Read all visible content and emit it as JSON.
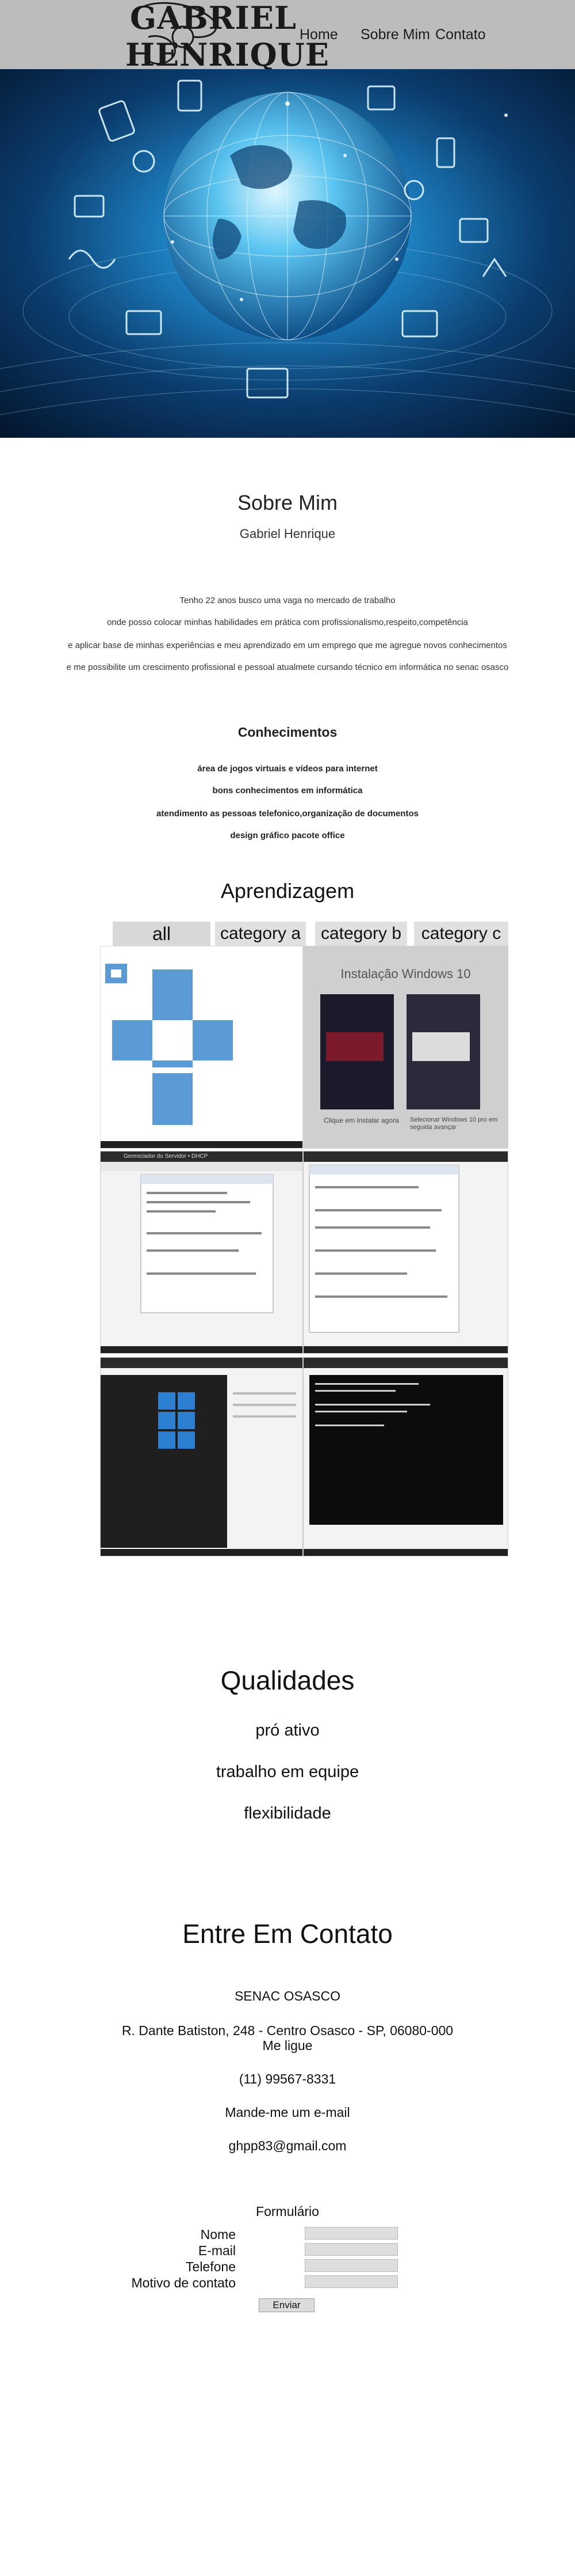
{
  "header": {
    "logo_line1": "GABRIEL",
    "logo_line2": "HENRIQUE",
    "nav": [
      {
        "label": "Home"
      },
      {
        "label": "Sobre Mim"
      },
      {
        "label": "Contato"
      }
    ]
  },
  "sobre": {
    "title": "Sobre Mim",
    "name": "Gabriel Henrique",
    "paragraph": [
      "Tenho 22 anos busco uma vaga no mercado de trabalho",
      "onde posso colocar minhas habilidades em prática com profissionalismo,respeito,competência",
      "e aplicar base de minhas experiências e meu aprendizado em um emprego que me agregue novos conhecimentos",
      "e me possibilite um crescimento profissional e pessoal atualmete cursando técnico em informática no senac osasco"
    ]
  },
  "conhecimentos": {
    "title": "Conhecimentos",
    "items": [
      "área de jogos virtuais e vídeos para internet",
      "bons conhecimentos em informática",
      "atendimento as pessoas telefonico,organização de documentos",
      "design gráfico pacote office"
    ]
  },
  "aprendizagem": {
    "title": "Aprendizagem",
    "tabs": [
      {
        "label": "all"
      },
      {
        "label": "category a"
      },
      {
        "label": "category b"
      },
      {
        "label": "category c"
      }
    ],
    "install_title": "Instalação Windows 10",
    "install_caption_left": "Clique em Instalar agora",
    "install_caption_right": "Selecionar Windows 10 pro em seguida avançar",
    "window_title": "Gerenciador do Servidor • DHCP"
  },
  "qualidades": {
    "title": "Qualidades",
    "items": [
      "pró ativo",
      "trabalho em equipe",
      "flexibilidade"
    ]
  },
  "contato": {
    "title": "Entre Em Contato",
    "school": "SENAC OSASCO",
    "address": "R. Dante Batiston, 248 - Centro Osasco - SP, 06080-000",
    "call": "Me ligue",
    "phone": "(11) 99567-8331",
    "email_prompt": "Mande-me um e-mail",
    "email": "ghpp83@gmail.com"
  },
  "formulario": {
    "title": "Formulário",
    "fields": [
      {
        "label": "Nome",
        "value": ""
      },
      {
        "label": "E-mail",
        "value": ""
      },
      {
        "label": "Telefone",
        "value": ""
      },
      {
        "label": "Motivo de contato",
        "value": ""
      }
    ],
    "submit": "Enviar"
  },
  "colors": {
    "header_bg": "#bcbcbc",
    "hero_dark": "#061a33",
    "hero_glow": "#4fc3ff",
    "tab_bg": "#e0e0e0",
    "input_bg": "#dedede"
  }
}
